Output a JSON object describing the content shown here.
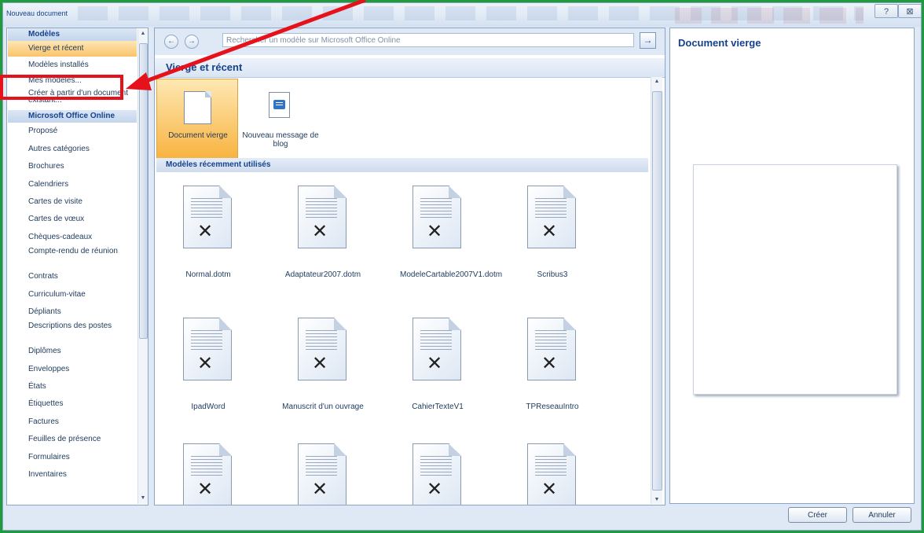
{
  "window": {
    "title": "Nouveau document",
    "help_icon": "?",
    "close_icon": "⊠"
  },
  "left_panel": {
    "items": [
      {
        "label": "Modèles",
        "kind": "header"
      },
      {
        "label": "Vierge et récent",
        "kind": "selected"
      },
      {
        "label": "Modèles installés",
        "kind": "item"
      },
      {
        "label": "Mes modèles...",
        "kind": "item"
      },
      {
        "label": "Créer à partir d'un document existant...",
        "kind": "item"
      },
      {
        "label": "Microsoft Office Online",
        "kind": "header"
      },
      {
        "label": "Proposé",
        "kind": "item"
      },
      {
        "label": "Autres catégories",
        "kind": "item"
      },
      {
        "label": "Brochures",
        "kind": "item"
      },
      {
        "label": "Calendriers",
        "kind": "item"
      },
      {
        "label": "Cartes de visite",
        "kind": "item"
      },
      {
        "label": "Cartes de vœux",
        "kind": "item"
      },
      {
        "label": "Chèques-cadeaux",
        "kind": "item"
      },
      {
        "label": "Compte-rendu de réunion",
        "kind": "item"
      },
      {
        "label": "Contrats",
        "kind": "item"
      },
      {
        "label": "Curriculum-vitae",
        "kind": "item"
      },
      {
        "label": "Dépliants",
        "kind": "item"
      },
      {
        "label": "Descriptions des postes",
        "kind": "item"
      },
      {
        "label": "Diplômes",
        "kind": "item"
      },
      {
        "label": "Enveloppes",
        "kind": "item"
      },
      {
        "label": "États",
        "kind": "item"
      },
      {
        "label": "Étiquettes",
        "kind": "item"
      },
      {
        "label": "Factures",
        "kind": "item"
      },
      {
        "label": "Feuilles de présence",
        "kind": "item"
      },
      {
        "label": "Formulaires",
        "kind": "item"
      },
      {
        "label": "Inventaires",
        "kind": "item"
      }
    ]
  },
  "middle_panel": {
    "search_placeholder": "Rechercher un modèle sur Microsoft Office Online",
    "back_icon": "←",
    "forward_icon": "→",
    "go_icon": "→",
    "section_title": "Vierge et récent",
    "tiles": [
      {
        "label": "Document vierge"
      },
      {
        "label": "Nouveau message de blog"
      }
    ],
    "recent_title": "Modèles récemment utilisés",
    "recent_templates": [
      {
        "label": "Normal.dotm"
      },
      {
        "label": "Adaptateur2007.dotm"
      },
      {
        "label": "ModeleCartable2007V1.dotm"
      },
      {
        "label": "Scribus3"
      },
      {
        "label": "IpadWord"
      },
      {
        "label": "Manuscrit d'un ouvrage"
      },
      {
        "label": "CahierTexteV1"
      },
      {
        "label": "TPReseauIntro"
      },
      {
        "label": ""
      },
      {
        "label": ""
      },
      {
        "label": ""
      },
      {
        "label": ""
      }
    ]
  },
  "right_panel": {
    "title": "Document vierge"
  },
  "buttons": {
    "create": "Créer",
    "cancel": "Annuler"
  },
  "annotation": {
    "color": "#e5121b"
  }
}
